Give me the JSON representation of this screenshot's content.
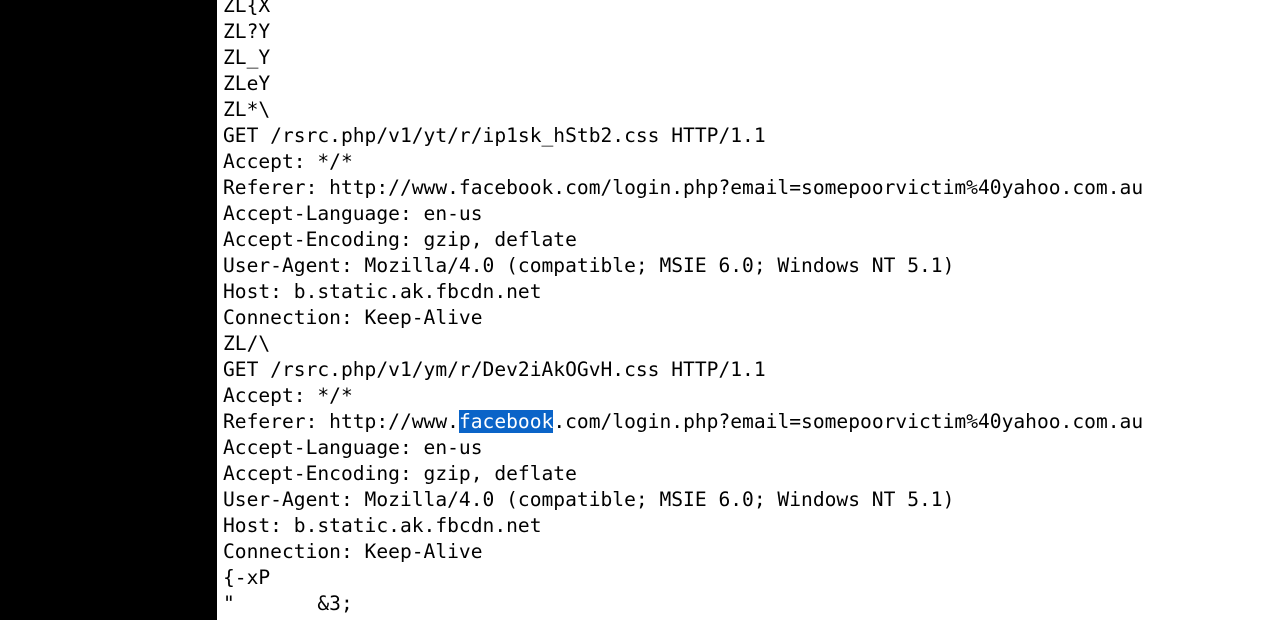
{
  "viewer": {
    "lines": [
      {
        "segments": [
          {
            "text": "ZL{X"
          }
        ]
      },
      {
        "segments": [
          {
            "text": "ZL?Y"
          }
        ]
      },
      {
        "segments": [
          {
            "text": "ZL_Y"
          }
        ]
      },
      {
        "segments": [
          {
            "text": "ZLeY"
          }
        ]
      },
      {
        "segments": [
          {
            "text": "ZL*\\"
          }
        ]
      },
      {
        "segments": [
          {
            "text": "GET /rsrc.php/v1/yt/r/ip1sk_hStb2.css HTTP/1.1"
          }
        ]
      },
      {
        "segments": [
          {
            "text": "Accept: */*"
          }
        ]
      },
      {
        "segments": [
          {
            "text": "Referer: http://www.facebook.com/login.php?email=somepoorvictim%40yahoo.com.au"
          }
        ]
      },
      {
        "segments": [
          {
            "text": "Accept-Language: en-us"
          }
        ]
      },
      {
        "segments": [
          {
            "text": "Accept-Encoding: gzip, deflate"
          }
        ]
      },
      {
        "segments": [
          {
            "text": "User-Agent: Mozilla/4.0 (compatible; MSIE 6.0; Windows NT 5.1)"
          }
        ]
      },
      {
        "segments": [
          {
            "text": "Host: b.static.ak.fbcdn.net"
          }
        ]
      },
      {
        "segments": [
          {
            "text": "Connection: Keep-Alive"
          }
        ]
      },
      {
        "segments": [
          {
            "text": "ZL/\\"
          }
        ]
      },
      {
        "segments": [
          {
            "text": "GET /rsrc.php/v1/ym/r/Dev2iAkOGvH.css HTTP/1.1"
          }
        ]
      },
      {
        "segments": [
          {
            "text": "Accept: */*"
          }
        ]
      },
      {
        "segments": [
          {
            "text": "Referer: http://www."
          },
          {
            "text": "facebook",
            "selected": true
          },
          {
            "text": ".com/login.php?email=somepoorvictim%40yahoo.com.au"
          }
        ]
      },
      {
        "segments": [
          {
            "text": "Accept-Language: en-us"
          }
        ]
      },
      {
        "segments": [
          {
            "text": "Accept-Encoding: gzip, deflate"
          }
        ]
      },
      {
        "segments": [
          {
            "text": "User-Agent: Mozilla/4.0 (compatible; MSIE 6.0; Windows NT 5.1)"
          }
        ]
      },
      {
        "segments": [
          {
            "text": "Host: b.static.ak.fbcdn.net"
          }
        ]
      },
      {
        "segments": [
          {
            "text": "Connection: Keep-Alive"
          }
        ]
      },
      {
        "segments": [
          {
            "text": "{-xP"
          }
        ]
      },
      {
        "segments": [
          {
            "text": "\"\t&3;"
          }
        ]
      }
    ]
  },
  "colors": {
    "background": "#000000",
    "pane": "#ffffff",
    "text": "#000000",
    "selection": "#0a64c8",
    "selection_text": "#ffffff"
  }
}
